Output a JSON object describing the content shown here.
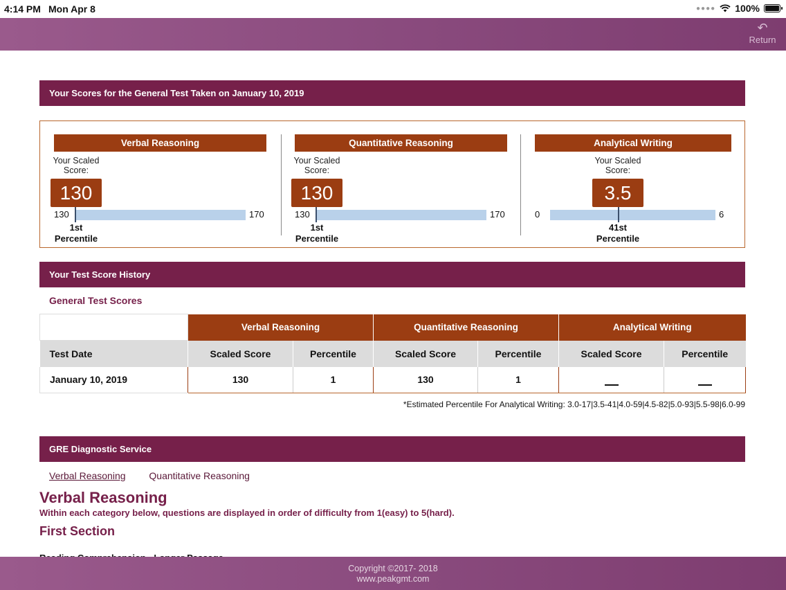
{
  "status_bar": {
    "time": "4:14 PM",
    "date": "Mon Apr 8",
    "battery": "100%"
  },
  "nav": {
    "return_label": "Return"
  },
  "scores_section": {
    "title": "Your Scores for the General Test Taken on January 10, 2019",
    "label": "Your Scaled Score:",
    "columns": [
      {
        "name": "Verbal Reasoning",
        "score": "130",
        "min": "130",
        "max": "170",
        "level": 0.0,
        "percentile_num": "1st",
        "percentile_word": "Percentile"
      },
      {
        "name": "Quantitative Reasoning",
        "score": "130",
        "min": "130",
        "max": "170",
        "level": 0.0,
        "percentile_num": "1st",
        "percentile_word": "Percentile"
      },
      {
        "name": "Analytical Writing",
        "score": "3.5",
        "min": "0",
        "max": "6",
        "level": 0.41,
        "percentile_num": "41st",
        "percentile_word": "Percentile"
      }
    ]
  },
  "history": {
    "title": "Your Test Score History",
    "subtitle": "General Test Scores",
    "groups": [
      "Verbal Reasoning",
      "Quantitative Reasoning",
      "Analytical Writing"
    ],
    "date_header": "Test Date",
    "scaled_header": "Scaled Score",
    "percentile_header": "Percentile",
    "rows": [
      {
        "date": "January 10, 2019",
        "vr_scaled": "130",
        "vr_pct": "1",
        "qr_scaled": "130",
        "qr_pct": "1"
      }
    ],
    "footnote": "*Estimated Percentile For Analytical Writing: 3.0-17|3.5-41|4.0-59|4.5-82|5.0-93|5.5-98|6.0-99"
  },
  "diagnostic": {
    "title": "GRE Diagnostic Service",
    "tabs": [
      "Verbal Reasoning",
      "Quantitative Reasoning"
    ],
    "heading": "Verbal Reasoning",
    "description": "Within each category below, questions are displayed in order of difficulty from 1(easy) to 5(hard).",
    "section_title": "First Section",
    "category": "Reading Comprehension - Longer Passage"
  },
  "footer": {
    "copyright": "Copyright ©2017- 2018",
    "url": "www.peakgmt.com"
  },
  "colors": {
    "brand": "#76204a",
    "accent": "#9b3d12",
    "bar": "#b9d1ea"
  }
}
